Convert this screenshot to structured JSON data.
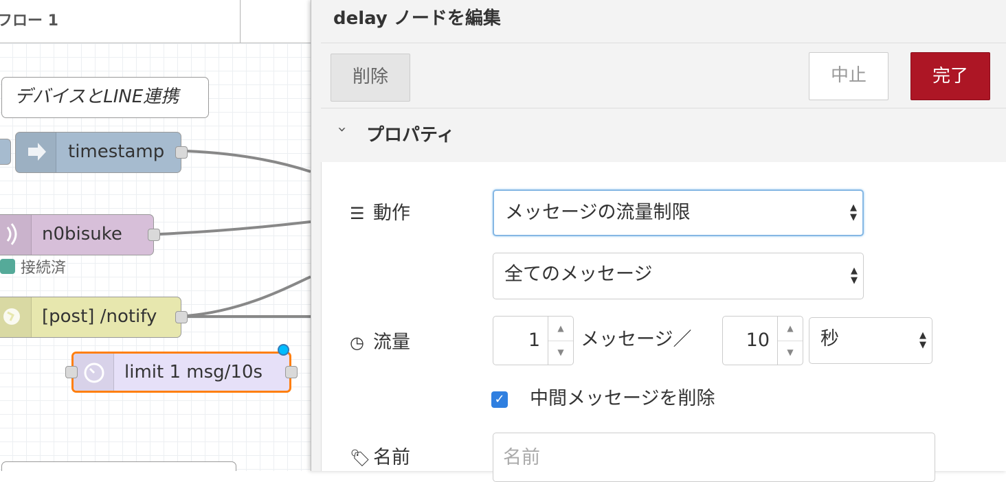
{
  "canvas": {
    "flow_tab_label": "フロー 1",
    "nodes": {
      "comment": "デバイスとLINE連携",
      "timestamp": "timestamp",
      "n0bisuke": "n0bisuke",
      "n0bisuke_status": "接続済",
      "http_in": "[post] /notify",
      "delay": "limit 1 msg/10s"
    },
    "colors": {
      "inject": "#a6bbcf",
      "mqtt": "#d7bfd9",
      "http": "#e7e7ae",
      "delay": "#e6e0f8",
      "selected_outline": "#ff7f0e",
      "status_connected": "#5a9"
    }
  },
  "tray": {
    "title": "delay ノードを編集",
    "delete_label": "削除",
    "cancel_label": "中止",
    "done_label": "完了",
    "section_title": "プロパティ",
    "action_label": "動作",
    "action_value": "メッセージの流量制限",
    "scope_value": "全てのメッセージ",
    "rate_label": "流量",
    "rate_count": "1",
    "rate_mid": "メッセージ／",
    "rate_period": "10",
    "rate_units": "秒",
    "drop_intermediate_label": "中間メッセージを削除",
    "drop_intermediate_checked": true,
    "name_label": "名前",
    "name_placeholder": "名前",
    "colors": {
      "done": "#ad1625"
    }
  }
}
